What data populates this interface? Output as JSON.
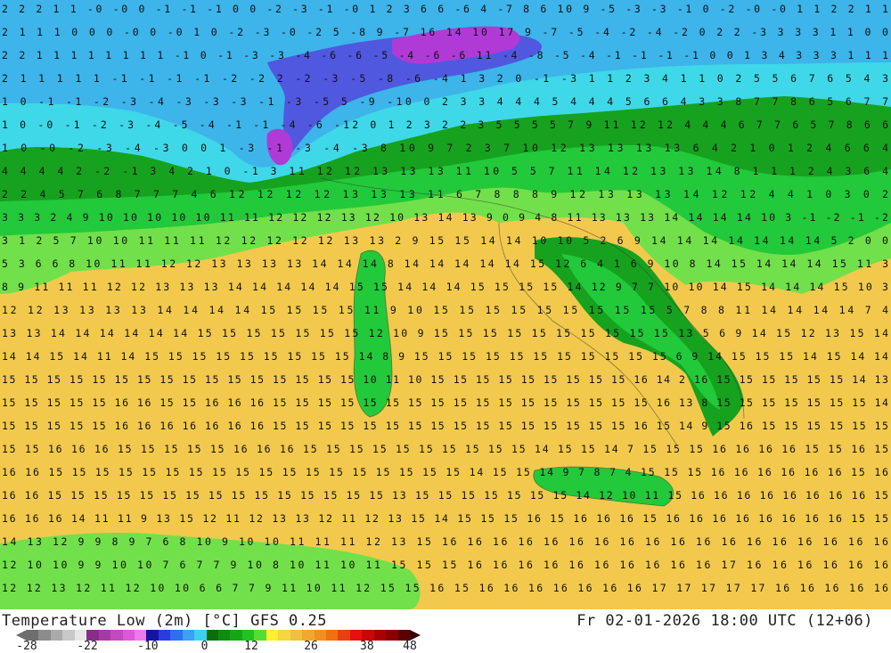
{
  "map": {
    "region": "Italy and central Mediterranean",
    "product": "Temperature Low (2m)",
    "unit": "°C",
    "colors": {
      "deep_cold": "#b03ad6",
      "very_cold": "#5058e0",
      "cold": "#3db4ea",
      "chilly": "#3ed8e8",
      "cool": "#16a21e",
      "mild": "#22c93a",
      "temperate": "#72e04a",
      "warm": "#f2c94c",
      "land_line": "#333333"
    },
    "value_rows": [
      {
        "row": 1,
        "text": "2  2  2  1  1 -0 -0  0 -1 -1 -1  0  0 -2 -3 -1 -0  1  2  3  6  6 -6  4 -7  8  6 10  9 -5 -3 -3 -1  0 -2 -0 -0  1  1  2  2  1  1"
      },
      {
        "row": 2,
        "text": "2  1  1  1  0  0  0 -0  0 -0  1  0 -2 -3 -0 -2  5 -8  9 -7 16 14 10 17  9 -7 -5 -4 -2 -4 -2  0  2  2 -3  3  3  3  1  1  0  0"
      },
      {
        "row": 3,
        "text": "2  2  1  1  1  1  1  1  1  1 -1  0 -1 -3 -3 -4 -6 -6 -5 -4 -6 -6 11 -4 -8 -5 -4 -1 -1 -1 -1  0  0  1  3  4  3  3  3  1  1  1"
      },
      {
        "row": 4,
        "text": "2  1  1  1  1  1 -1 -1 -1 -1 -2 -2  2 -2 -3 -5 -8 -6 -4  1  3  2  0 -1 -3  1  1  2  3  4  1  1  0  2  5  5  6  7  6  5  4  3"
      },
      {
        "row": 5,
        "text": "1  0 -1 -1 -2 -3 -4 -3 -3 -3 -1 -3 -5  5 -9 -10  0  2  3  3  4  4  4  5  4  4  4  5  6  6  4  3  3  8  7  7  8  6  5  6  7  7"
      },
      {
        "row": 6,
        "text": "1  0 -0 -1 -2 -3 -4 -5 -4 -1 -1 -4 -6 -12  0  1  2  3  2  2  3  5  5  5  5  7  9 11 12 12  4  4  4  6  7  7  6  5  7  8  6  6"
      },
      {
        "row": 7,
        "text": "1  0 -0 -2 -3 -4 -3  0  0  1 -3 -1 -3 -4 -3  8 10  9  7  2  3  7 10 12 13 13 13 13  6  4  2  1  0  1  2  4  6  6  4"
      },
      {
        "row": 8,
        "text": "4  4  4  4  2 -2 -1  3  4  2  1  0 -1  3 11 12 12 13 13 13 11 10  5  5  7 11 14 12 13 13 14  8  1  1  1  2  4  3  6  4"
      },
      {
        "row": 9,
        "text": "2  2  4  5  7  6  8  7  7  7  4  6 12 12 12 12 13 13 13 11  6  7  8  8  8  9 12 13 13 13 14 12 12  4  4  1  0  3  0  2"
      },
      {
        "row": 10,
        "text": "3  3  3  2  4  9 10 10 10 10 10 11 11 12 12 12 13 12 10 13 14 13  9  0  9  4  8 11 13 13 13 14 14 14 14 10  3 -1 -2 -1 -2"
      },
      {
        "row": 11,
        "text": "3  1  2  5  7 10 10 11 11 11 12 12 12 12 12 13 13  2  9 15 15 14 14 10 10  5  2  6  9 14 14 14 14 14 14 14  5  2  0  0"
      },
      {
        "row": 12,
        "text": "5  3  6  6  8 10 11 11 12 12 13 13 13 13 14 14 14  8 14 14 14 14 14 15 12  6  4  1  6  9 10  8 14 15 14 14 14 15 11  3"
      },
      {
        "row": 13,
        "text": "8  9 11 11 11 12 12 13 13 13 14 14 14 14 14 15 15 14 14 14 15 15 15 15 14 12  9  7  7 10 10 14 15 14 14 14 15 10  3"
      },
      {
        "row": 14,
        "text": "12 12 13 13 13 13 14 14 14 14 15 15 15 15 11  9 10 15 15 15 15 15 15 15 15 15  5  7  8  8 11 14 14 14 14  7  4"
      },
      {
        "row": 15,
        "text": "13 13 14 14 14 14 14 14 15 15 15 15 15 15 15 12 10  9 15 15 15 15 15 15 15 15 15 15 13  5  6  9 14 15 12 13 15 14"
      },
      {
        "row": 16,
        "text": "14 14 15 14 11 14 15 15 15 15 15 15 15 15 15 14  8  9 15 15 15 15 15 15 15 15 15 15 15  6  9 14 15 15 15 14 15 14 14"
      },
      {
        "row": 17,
        "text": "15 15 15 15 15 15 15 15 15 15 15 15 15 15 15 15 10 11 10 15 15 15 15 15 15 15 15 15 16 14  2 16 15 15 15 15 15 15 14 13"
      },
      {
        "row": 18,
        "text": "15 15 15 15 15 16 16 15 15 16 16 16 15 15 15 15 15 15 15 15 15 15 15 15 15 15 15 15 15 16 13  8 15 15 15 15 15 15 15 14"
      },
      {
        "row": 19,
        "text": "15 15 15 15 15 16 16 16 16 16 16 16 15 15 15 15 15 15 15 15 15 15 15 15 15 15 15 15 16 15 14  9 15 16 15 15 15 15 15 15"
      },
      {
        "row": 20,
        "text": "15 15 16 16 16 15 15 15 15 15 16 16 16 15 15 15 15 15 15 15 15 15 15 14 15 15 14  7 15 15 15 16 16 16 16 15 15 16 15"
      },
      {
        "row": 21,
        "text": "16 16 15 15 15 15 15 15 15 15 15 15 15 15 15 15 15 15 15 15 14 15 15 14  9  7  8  7  4 15 15 15 16 16 16 16 16 16 15 16"
      },
      {
        "row": 22,
        "text": "16 16 15 15 15 15 15 15 15 15 15 15 15 15 15 15 15 13 15 15 15 15 15 15 15 14 12 10 11 15 16 16 16 16 16 16 16 16 15"
      },
      {
        "row": 23,
        "text": "16 16 16 14 11 11  9 13 15 12 11 12 13 13 12 11 12 13 15 14 15 15 15 16 15 16 16 16 15 16 16 16 16 16 16 16 16 15 15"
      },
      {
        "row": 24,
        "text": "14 13 12  9  9  8  9  7  6  8 10  9 10 10 11 11 11 12 13 15 16 16 16 16 16 16 16 16 16 16 16 16 16 16 16 16 16 16"
      },
      {
        "row": 25,
        "text": "12 10 10  9  9 10 10  7  6  7  7  9 10  8 10 11 10 11 15 15 15 16 16 16 16 16 16 16 16 16 16 17 16 16 16 16 16 16"
      },
      {
        "row": 26,
        "text": "12 12 13 12 11 12 10 10  6  6  7  7  9 11 10 11 12 15 15 16 15 16 16 16 16 16 16 16 17 17 17 17 17 16 16 16 16 16"
      }
    ]
  },
  "footer": {
    "title_left": "Temperature Low (2m) [°C] GFS 0.25",
    "title_right": "Fr 02-01-2026 18:00 UTC (12+06)",
    "colorbar": {
      "colors": [
        "#6e6e6e",
        "#8c8c8c",
        "#aaaaaa",
        "#c8c8c8",
        "#e6e6e6",
        "#8a2d8a",
        "#a43aa4",
        "#c04ac0",
        "#d85ad8",
        "#eb7aeb",
        "#1414a0",
        "#2a3ce0",
        "#2e6ef0",
        "#3aa0f5",
        "#3ed0f0",
        "#0b6e0b",
        "#108a10",
        "#17a617",
        "#22c222",
        "#55dd33",
        "#ffef2e",
        "#f5d640",
        "#f0c040",
        "#f0a830",
        "#f09020",
        "#f07010",
        "#e84010",
        "#e81010",
        "#c80808",
        "#a80000",
        "#880000",
        "#5a0000"
      ],
      "ticks": [
        {
          "label": "-28",
          "pos": 0.0
        },
        {
          "label": "-22",
          "pos": 0.158
        },
        {
          "label": "-10",
          "pos": 0.316
        },
        {
          "label": "0",
          "pos": 0.464
        },
        {
          "label": "12",
          "pos": 0.586
        },
        {
          "label": "26",
          "pos": 0.742
        },
        {
          "label": "38",
          "pos": 0.888
        },
        {
          "label": "48",
          "pos": 1.0
        }
      ]
    }
  }
}
